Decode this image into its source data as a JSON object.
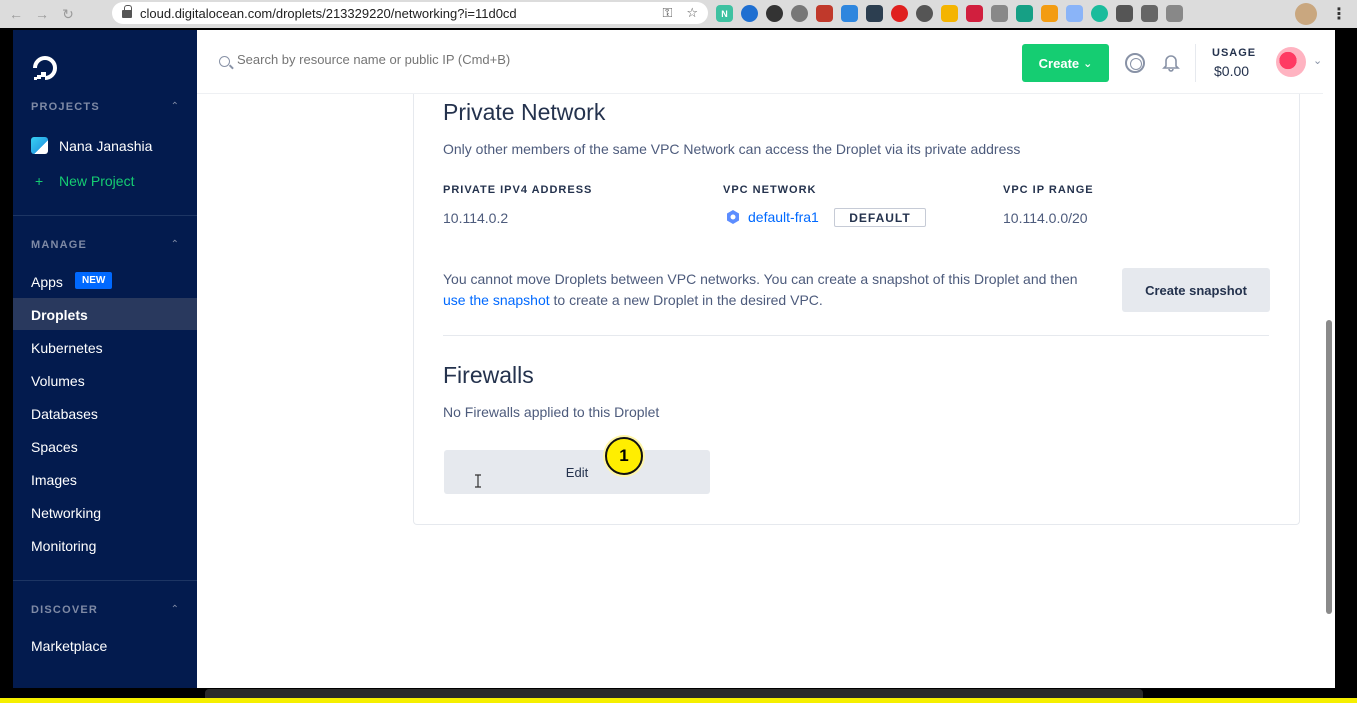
{
  "browser": {
    "url": "cloud.digitalocean.com/droplets/213329220/networking?i=11d0cd"
  },
  "header": {
    "search_placeholder": "Search by resource name or public IP (Cmd+B)",
    "create_label": "Create",
    "usage_label": "USAGE",
    "usage_value": "$0.00"
  },
  "sidebar": {
    "projects_section": "PROJECTS",
    "project_name": "Nana Janashia",
    "new_project": "New Project",
    "manage_section": "MANAGE",
    "items": [
      {
        "label": "Apps"
      },
      {
        "label": "Droplets"
      },
      {
        "label": "Kubernetes"
      },
      {
        "label": "Volumes"
      },
      {
        "label": "Databases"
      },
      {
        "label": "Spaces"
      },
      {
        "label": "Images"
      },
      {
        "label": "Networking"
      },
      {
        "label": "Monitoring"
      }
    ],
    "apps_badge": "NEW",
    "discover_section": "DISCOVER",
    "marketplace": "Marketplace"
  },
  "private_network": {
    "title": "Private Network",
    "description": "Only other members of the same VPC Network can access the Droplet via its private address",
    "columns": {
      "ipv4": "PRIVATE IPV4 ADDRESS",
      "vpc": "VPC NETWORK",
      "range": "VPC IP RANGE"
    },
    "ipv4_value": "10.114.0.2",
    "vpc_value": "default-fra1",
    "vpc_badge": "DEFAULT",
    "range_value": "10.114.0.0/20",
    "info_prefix": "You cannot move Droplets between VPC networks. You can create a snapshot of this Droplet and then ",
    "info_link": "use the snapshot",
    "info_suffix": " to create a new Droplet in the desired VPC.",
    "snapshot_button": "Create snapshot"
  },
  "firewalls": {
    "title": "Firewalls",
    "description": "No Firewalls applied to this Droplet",
    "edit_button": "Edit"
  },
  "annotation": {
    "marker_number": "1"
  },
  "colors": {
    "sidebar_bg": "#031b4e",
    "create_green": "#15cd72",
    "link_blue": "#0069ff",
    "marker_yellow": "#ffee00"
  }
}
